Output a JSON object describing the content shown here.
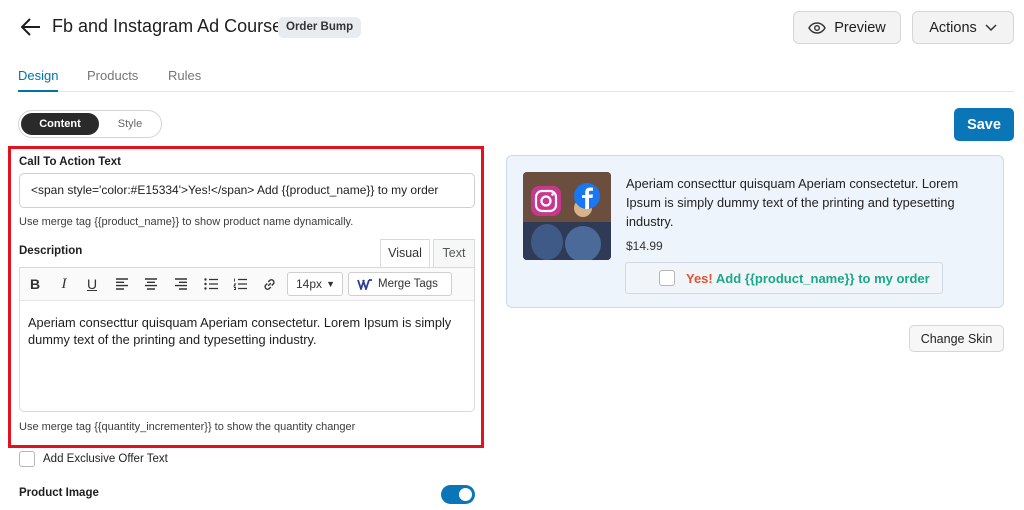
{
  "header": {
    "title": "Fb and Instagram Ad Course",
    "badge": "Order Bump",
    "preview_label": "Preview",
    "actions_label": "Actions"
  },
  "tabs": [
    {
      "label": "Design",
      "active": true
    },
    {
      "label": "Products",
      "active": false
    },
    {
      "label": "Rules",
      "active": false
    }
  ],
  "segment": {
    "content": "Content",
    "style": "Style"
  },
  "save_label": "Save",
  "form": {
    "cta_label": "Call To Action Text",
    "cta_value": "<span style='color:#E15334'>Yes!</span> Add {{product_name}} to my order",
    "cta_help": "Use merge tag {{product_name}} to show product name dynamically.",
    "description_label": "Description",
    "editor_tabs": {
      "visual": "Visual",
      "text": "Text"
    },
    "font_size": "14px",
    "merge_tags_label": "Merge Tags",
    "description_text": "Aperiam consecttur quisquam Aperiam consectetur. Lorem Ipsum is simply dummy text of the printing and typesetting industry.",
    "description_help": "Use merge tag {{quantity_incrementer}} to show the quantity changer",
    "exclusive_offer_label": "Add Exclusive Offer Text",
    "product_image_label": "Product Image",
    "product_image_enabled": true
  },
  "preview": {
    "description": "Aperiam consecttur quisquam Aperiam consectetur. Lorem Ipsum is simply dummy text of the printing and typesetting industry.",
    "price": "$14.99",
    "cta_yes": "Yes!",
    "cta_rest": "Add {{product_name}} to my order",
    "change_skin_label": "Change Skin"
  },
  "colors": {
    "accent": "#0a76b7",
    "highlight": "#e3121c",
    "cta_yes": "#E15334",
    "cta_rest": "#1aa987"
  }
}
